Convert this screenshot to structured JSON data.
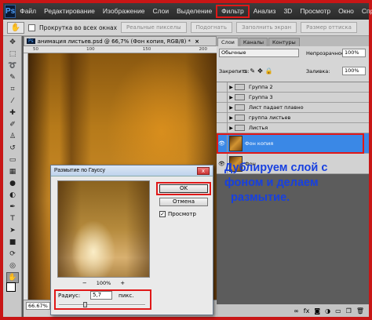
{
  "app": {
    "logo": "Ps"
  },
  "menu": [
    {
      "label": "Файл",
      "highlighted": false
    },
    {
      "label": "Редактирование",
      "highlighted": false
    },
    {
      "label": "Изображение",
      "highlighted": false
    },
    {
      "label": "Слои",
      "highlighted": false
    },
    {
      "label": "Выделение",
      "highlighted": false
    },
    {
      "label": "Фильтр",
      "highlighted": true
    },
    {
      "label": "Анализ",
      "highlighted": false
    },
    {
      "label": "3D",
      "highlighted": false
    },
    {
      "label": "Просмотр",
      "highlighted": false
    },
    {
      "label": "Окно",
      "highlighted": false
    },
    {
      "label": "Справка",
      "highlighted": false
    }
  ],
  "options_bar": {
    "tool_icon": "hand-icon",
    "scroll_all_label": "Прокрутка во всех окнах",
    "buttons": [
      "Реальные пикселы",
      "Подогнать",
      "Заполнить экран",
      "Размер оттиска"
    ]
  },
  "document": {
    "tab_icon": "Ps",
    "tab_title": "анимация листьев.psd @ 66,7% (Фон копия, RGB/8) *",
    "close": "×",
    "zoom": "66.67%",
    "ruler_ticks": [
      "50",
      "100",
      "150",
      "200"
    ]
  },
  "tools": [
    "move",
    "marquee",
    "lasso",
    "quick-select",
    "crop",
    "eyedropper",
    "healing",
    "brush",
    "stamp",
    "history-brush",
    "eraser",
    "gradient",
    "blur",
    "dodge",
    "pen",
    "type",
    "path-select",
    "shape",
    "3d-rotate",
    "3d-camera",
    "hand",
    "zoom"
  ],
  "layers_panel": {
    "tabs": [
      {
        "label": "Слои",
        "active": true
      },
      {
        "label": "Каналы",
        "active": false
      },
      {
        "label": "Контуры",
        "active": false
      }
    ],
    "blend_mode": "Обычные",
    "opacity_label": "Непрозрачность:",
    "opacity_value": "100%",
    "lock_label": "Закрепить:",
    "fill_label": "Заливка:",
    "fill_value": "100%",
    "layers": [
      {
        "name": "Группа 2",
        "type": "group",
        "visible": false
      },
      {
        "name": "Группа 3",
        "type": "group",
        "visible": false
      },
      {
        "name": "Лист падает плавно",
        "type": "group",
        "visible": false
      },
      {
        "name": "группа листьев",
        "type": "group",
        "visible": false
      },
      {
        "name": "Листья",
        "type": "group",
        "visible": false
      },
      {
        "name": "Фон копия",
        "type": "image",
        "visible": true,
        "selected": true
      },
      {
        "name": "Фон",
        "type": "image",
        "visible": true,
        "selected": false
      }
    ]
  },
  "annotation": {
    "lines": [
      "Дублируем слой с",
      "фоном и делаем",
      "размытие."
    ],
    "color": "#1740e0"
  },
  "gaussian_dialog": {
    "title": "Размытие по Гауссу",
    "close": "x",
    "ok_label": "OK",
    "cancel_label": "Отмена",
    "preview_label": "Просмотр",
    "preview_checked": true,
    "zoom_out": "−",
    "zoom_pct": "100%",
    "zoom_in": "+",
    "radius_label": "Радиус:",
    "radius_value": "5,7",
    "radius_unit": "пикс.",
    "radius_slider_fraction": 0.3
  },
  "accent_colors": {
    "highlight": "#e01818",
    "selection": "#3a88e6"
  }
}
